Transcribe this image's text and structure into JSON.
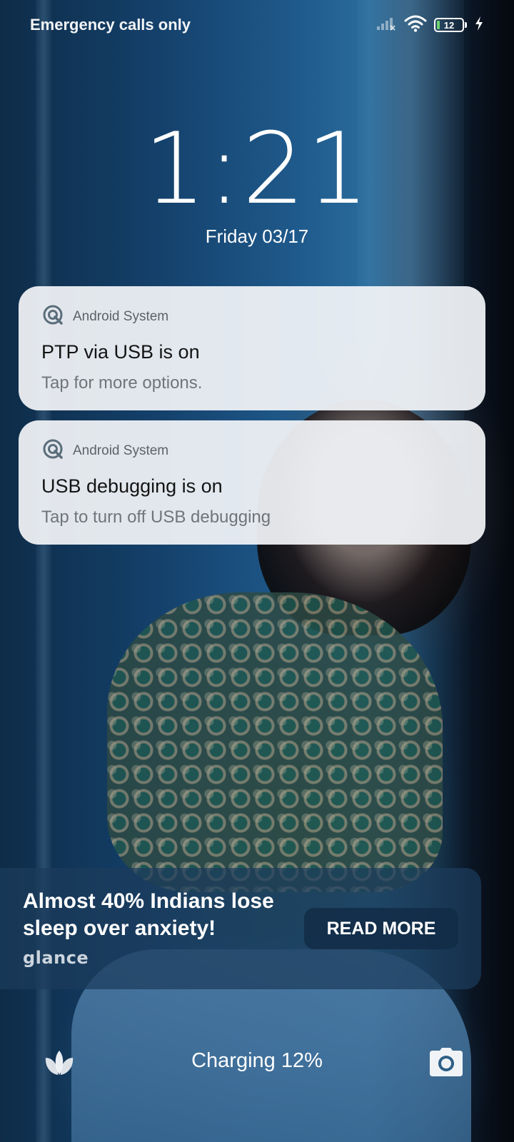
{
  "status_bar": {
    "carrier_text": "Emergency calls only",
    "battery_level": "12",
    "icons": [
      "signal-off-icon",
      "wifi-icon",
      "battery-icon",
      "charging-bolt-icon"
    ]
  },
  "lockscreen": {
    "time": "1:21",
    "date": "Friday 03/17"
  },
  "notifications": [
    {
      "app_name": "Android System",
      "title": "PTP via USB is on",
      "body": "Tap for more options.",
      "icon": "android-system-icon"
    },
    {
      "app_name": "Android System",
      "title": "USB debugging is on",
      "body": "Tap to turn off USB debugging",
      "icon": "android-system-icon"
    }
  ],
  "glance": {
    "headline": "Almost 40% Indians lose sleep over anxiety!",
    "brand": "glance",
    "cta_label": "READ MORE"
  },
  "bottom": {
    "charging_text": "Charging 12%",
    "left_shortcut": "glance-lotus-icon",
    "right_shortcut": "camera-icon"
  },
  "colors": {
    "notification_bg": "#f2f4f7",
    "glance_card_bg": "#1c3c5c",
    "battery_fill": "#6fd36f"
  }
}
